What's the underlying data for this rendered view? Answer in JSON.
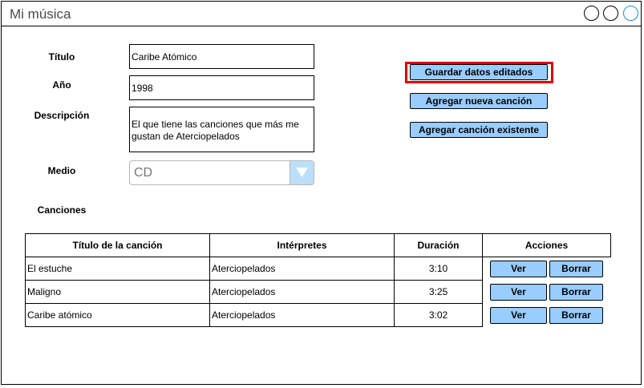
{
  "window": {
    "title": "Mi música"
  },
  "form": {
    "titulo_label": "Título",
    "titulo_value": "Caribe Atómico",
    "anio_label": "Año",
    "anio_value": "1998",
    "descripcion_label": "Descripción",
    "descripcion_value": "El que tiene las canciones que más me gustan de Aterciopelados",
    "medio_label": "Medio",
    "medio_value": "CD",
    "canciones_label": "Canciones"
  },
  "actions": {
    "guardar_label": "Guardar datos editados",
    "agregar_nueva_label": "Agregar nueva canción",
    "agregar_existente_label": "Agregar canción existente"
  },
  "table": {
    "headers": [
      "Título de la canción",
      "Intérpretes",
      "Duración",
      "Acciones"
    ],
    "rows": [
      {
        "titulo": "El estuche",
        "interpretes": "Aterciopelados",
        "duracion": "3:10",
        "ver": "Ver",
        "borrar": "Borrar"
      },
      {
        "titulo": "Maligno",
        "interpretes": "Aterciopelados",
        "duracion": "3:25",
        "ver": "Ver",
        "borrar": "Borrar"
      },
      {
        "titulo": "Caribe atómico",
        "interpretes": "Aterciopelados",
        "duracion": "3:02",
        "ver": "Ver",
        "borrar": "Borrar"
      }
    ]
  },
  "colors": {
    "button_fill": "#99ccff",
    "highlight": "#e00000",
    "dropdown_arrow_bg": "#bcdff7",
    "window_control_accent": "#1e8fd6"
  },
  "icons": {
    "dropdown": "triangle-down-icon"
  }
}
